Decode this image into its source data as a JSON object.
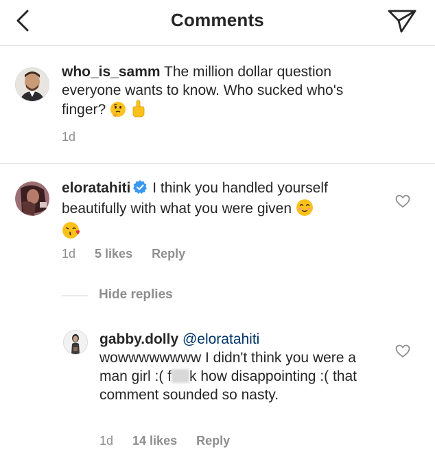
{
  "header": {
    "title": "Comments"
  },
  "caption": {
    "username": "who_is_samm",
    "text": " The million dollar question everyone wants to know. Who sucked who's finger? ",
    "time": "1d"
  },
  "comments": [
    {
      "username": "eloratahiti",
      "verified": true,
      "text": " I think you handled yourself beautifully with what you were given ",
      "time": "1d",
      "likes": "5 likes",
      "reply_label": "Reply"
    }
  ],
  "thread": {
    "hide_label": "Hide replies"
  },
  "reply": {
    "username": "gabby.dolly",
    "mention": "@eloratahiti",
    "text_before": "wowwwwwwww I didn't think you were a man girl :( f",
    "text_after": "k how disappointing :( that comment sounded so nasty.",
    "time": "1d",
    "likes": "14 likes",
    "reply_label": "Reply"
  },
  "icons": {
    "back": "chevron-left-icon",
    "send": "paper-plane-icon",
    "heart": "heart-outline-icon",
    "verified": "verified-badge-icon"
  },
  "colors": {
    "text": "#262626",
    "meta": "#8e8e8e",
    "divider": "#dbdbdb",
    "verified": "#3897f0"
  }
}
